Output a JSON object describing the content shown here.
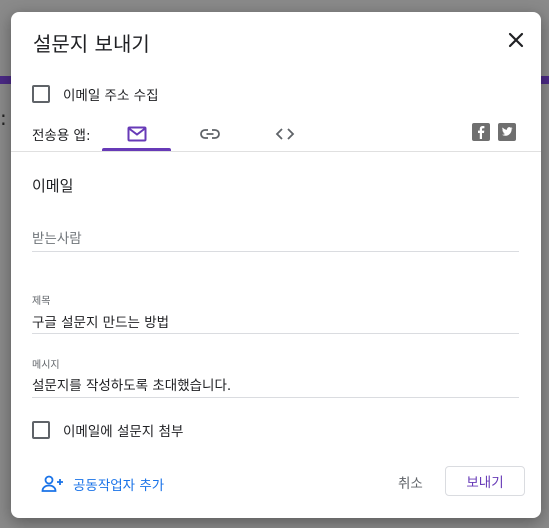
{
  "dialog": {
    "title": "설문지 보내기",
    "collect_email_label": "이메일 주소 수집",
    "send_via_label": "전송용 앱:",
    "tabs": [
      {
        "icon": "email-icon",
        "active": true
      },
      {
        "icon": "link-icon",
        "active": false
      },
      {
        "icon": "embed-icon",
        "active": false
      }
    ],
    "social": [
      "facebook-icon",
      "twitter-icon"
    ]
  },
  "email_section": {
    "title": "이메일",
    "to": {
      "placeholder": "받는사람"
    },
    "subject": {
      "label": "제목",
      "value": "구글 설문지 만드는 방법"
    },
    "message": {
      "label": "메시지",
      "value": "설문지를 작성하도록 초대했습니다."
    },
    "attach_label": "이메일에 설문지 첨부"
  },
  "footer": {
    "add_collaborators": "공동작업자 추가",
    "cancel": "취소",
    "send": "보내기"
  },
  "colors": {
    "accent": "#673ab7",
    "link": "#1a73e8"
  }
}
